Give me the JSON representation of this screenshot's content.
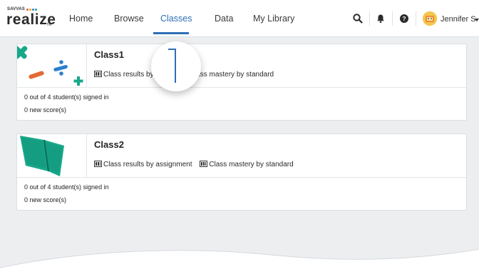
{
  "brand": {
    "small_text": "SAVVAS",
    "name": "realize",
    "tm": "TM"
  },
  "nav": {
    "items": [
      {
        "label": "Home"
      },
      {
        "label": "Browse"
      },
      {
        "label": "Classes",
        "active": true
      },
      {
        "label": "Data"
      },
      {
        "label": "My Library"
      }
    ]
  },
  "header_icons": [
    "search-icon",
    "bell-icon",
    "help-icon"
  ],
  "user": {
    "name": "Jennifer S."
  },
  "classes": [
    {
      "name": "Class1",
      "links": [
        "Class results by assignment",
        "Class mastery by standard"
      ],
      "links_display": [
        "Class results by a",
        "Class mastery by standard"
      ],
      "students_signed_in": "0 out of 4 student(s) signed in",
      "new_scores": "0 new score(s)"
    },
    {
      "name": "Class2",
      "links": [
        "Class results by assignment",
        "Class mastery by standard"
      ],
      "links_display": [
        "Class results by assignment",
        "Class mastery by standard"
      ],
      "students_signed_in": "0 out of 4 student(s) signed in",
      "new_scores": "0 new score(s)"
    }
  ],
  "colors": {
    "accent": "#2f6fb6",
    "background": "#eceef0",
    "card": "#ffffff",
    "thumb_green": "#17a88a",
    "thumb_orange": "#e36b33",
    "thumb_blue": "#2b7fcf"
  }
}
